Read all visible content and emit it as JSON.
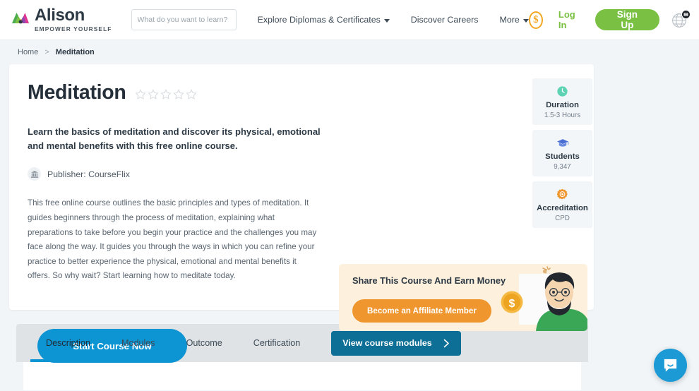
{
  "header": {
    "logo": {
      "name": "Alison",
      "tagline": "EMPOWER YOURSELF",
      "icon": "alison-logo-icon"
    },
    "search": {
      "placeholder": "What do you want to learn?",
      "value": "",
      "icon": "search-icon"
    },
    "nav": [
      {
        "label": "Explore Diplomas & Certificates",
        "has_caret": true
      },
      {
        "label": "Discover Careers",
        "has_caret": false
      },
      {
        "label": "More",
        "has_caret": true
      }
    ],
    "coin_icon": "dollar-coin-icon",
    "coin_symbol": "$",
    "login_label": "Log In",
    "signup_label": "Sign Up",
    "globe_icon": "globe-language-icon",
    "colors": {
      "brand_green": "#7ac143",
      "coin_orange": "#f5a623"
    }
  },
  "breadcrumb": {
    "home": "Home",
    "separator": ">",
    "current": "Meditation"
  },
  "hero": {
    "title": "Meditation",
    "rating": {
      "stars_total": 5,
      "stars_filled": 0
    },
    "subtitle": "Learn the basics of meditation and discover its physical, emotional and mental benefits with this free online course.",
    "publisher_icon": "institution-icon",
    "publisher": "Publisher: CourseFlix",
    "description": "This free online course outlines the basic principles and types of meditation. It guides beginners through the process of meditation, explaining what preparations to take before you begin your practice and the challenges you may face along the way. It guides you through the ways in which you can refine your practice to better experience the physical, emotional and mental benefits it offers. So why wait? Start learning how to meditate today.",
    "start_button": "Start Course Now",
    "start_button_color": "#0d94d2"
  },
  "info_cards": [
    {
      "icon": "clock-icon",
      "label": "Duration",
      "value": "1.5-3 Hours",
      "icon_color": "#5ed3b4"
    },
    {
      "icon": "graduation-cap-icon",
      "label": "Students",
      "value": "9,347",
      "icon_color": "#4a6fd4"
    },
    {
      "icon": "accreditation-badge-icon",
      "label": "Accreditation",
      "value": "CPD",
      "icon_color": "#f0962e"
    }
  ],
  "affiliate": {
    "title": "Share This Course And Earn Money",
    "button": "Become an Affiliate Member",
    "button_color": "#f0962e",
    "background_color": "#fdf0dd",
    "art_icon": "affiliate-illustration"
  },
  "tabs": {
    "items": [
      {
        "label": "Description",
        "active": true
      },
      {
        "label": "Modules",
        "active": false
      },
      {
        "label": "Outcome",
        "active": false
      },
      {
        "label": "Certification",
        "active": false
      }
    ],
    "modules_button": "View course modules",
    "modules_button_icon": "chevron-right-icon",
    "active_underline_color": "#0d94d2"
  },
  "chat": {
    "icon": "chat-bubble-icon",
    "color": "#1c9ad6"
  }
}
